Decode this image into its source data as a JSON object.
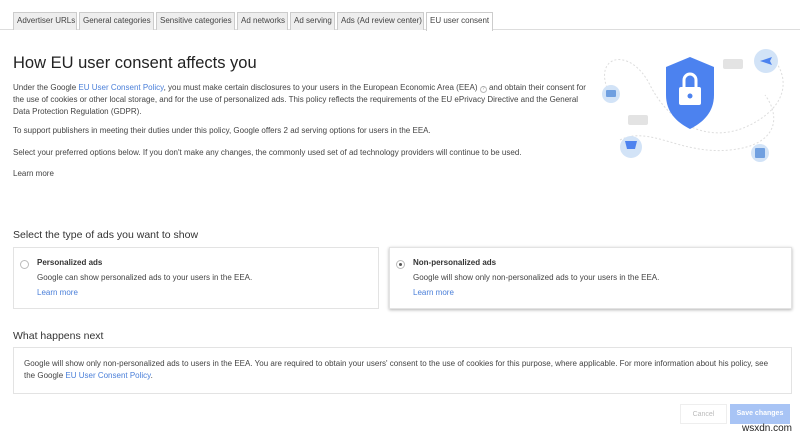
{
  "tabs": [
    "Advertiser URLs",
    "General categories",
    "Sensitive categories",
    "Ad networks",
    "Ad serving",
    "Ads (Ad review center)",
    "EU user consent"
  ],
  "active_tab": "EU user consent",
  "title": "How EU user consent affects you",
  "intro": {
    "pre": "Under the Google ",
    "link": "EU User Consent Policy",
    "mid": ", you must make certain disclosures to your users in the European Economic Area (EEA) ",
    "help_icon": "?",
    "post": " and obtain their consent for the use of cookies or other local storage, and for the use of personalized ads. This policy reflects the requirements of the EU ePrivacy Directive and the General Data Protection Regulation (GDPR)."
  },
  "para2": "To support publishers in meeting their duties under this policy, Google offers 2 ad serving options for users in the EEA.",
  "para3": "Select your preferred options below. If you don't make any changes, the commonly used set of ad technology providers will continue to be used.",
  "learn_more": "Learn more",
  "select_heading": "Select the type of ads you want to show",
  "options": [
    {
      "title": "Personalized ads",
      "desc": "Google can show personalized ads to your users in the EEA.",
      "link": "Learn more",
      "selected": false
    },
    {
      "title": "Non-personalized ads",
      "desc": "Google will show only non-personalized ads to your users in the EEA.",
      "link": "Learn more",
      "selected": true
    }
  ],
  "next_heading": "What happens next",
  "next": {
    "text": "Google will show only non-personalized ads to users in the EEA. You are required to obtain your users' consent to the use of cookies for this purpose, where applicable. For more information about his policy, see the Google ",
    "link": "EU User Consent Policy",
    "end": "."
  },
  "buttons": {
    "cancel": "Cancel",
    "save": "Save changes"
  },
  "watermark": "wsxdn.com",
  "colors": {
    "accent": "#4a7fd9",
    "shield": "#4c82ef",
    "save_disabled": "#a8c4f5"
  }
}
